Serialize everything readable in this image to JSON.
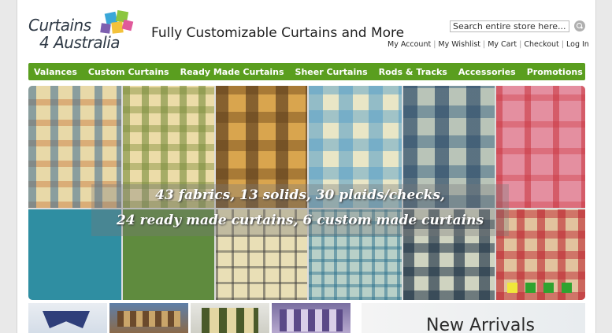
{
  "brand": {
    "logo_line1": "Curtains",
    "logo_line2": "4 Australia",
    "tagline": "Fully Customizable Curtains and More"
  },
  "search": {
    "value": "Search entire store here..."
  },
  "account_links": [
    "My Account",
    "My Wishlist",
    "My Cart",
    "Checkout",
    "Log In"
  ],
  "nav": [
    "Valances",
    "Custom Curtains",
    "Ready Made Curtains",
    "Sheer Curtains",
    "Rods & Tracks",
    "Accessories",
    "Promotions"
  ],
  "banner": {
    "line1": "43 fabrics, 13 solids, 30 plaids/checks,",
    "line2": "24 ready made curtains, 6 custom made curtains",
    "slides": 4,
    "active_slide": 1
  },
  "new_arrivals": {
    "label": "New Arrivals"
  },
  "colors": {
    "nav_green": "#5a9e1f",
    "dot_green": "#2fa32f",
    "dot_active": "#f0e83a"
  }
}
